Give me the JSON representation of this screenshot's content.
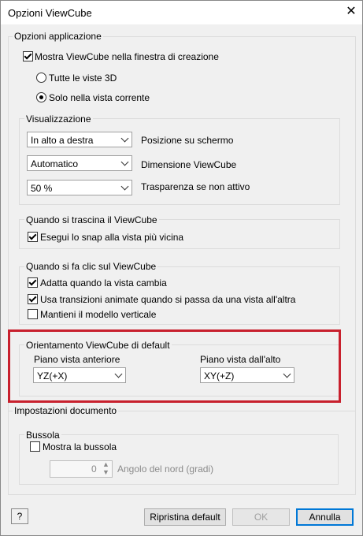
{
  "window": {
    "title": "Opzioni ViewCube",
    "close_icon": "close-icon"
  },
  "app_options": {
    "legend": "Opzioni applicazione",
    "show_viewcube": {
      "label": "Mostra ViewCube nella finestra di creazione",
      "checked": true
    },
    "all_views": {
      "label": "Tutte le viste 3D",
      "selected": false
    },
    "current_view": {
      "label": "Solo nella vista corrente",
      "selected": true
    }
  },
  "display": {
    "legend": "Visualizzazione",
    "position": {
      "value": "In alto a destra",
      "label": "Posizione su schermo"
    },
    "size": {
      "value": "Automatico",
      "label": "Dimensione ViewCube"
    },
    "transparency": {
      "value": "50 %",
      "label": "Trasparenza se non attivo"
    }
  },
  "drag": {
    "legend": "Quando si trascina il ViewCube",
    "snap": {
      "label": "Esegui lo snap alla vista più vicina",
      "checked": true
    }
  },
  "click": {
    "legend": "Quando si fa clic sul ViewCube",
    "fit": {
      "label": "Adatta quando la vista cambia",
      "checked": true
    },
    "animated": {
      "label": "Usa transizioni animate quando si passa da una vista all'altra",
      "checked": true
    },
    "upright": {
      "label": "Mantieni il modello verticale",
      "checked": false
    }
  },
  "orientation": {
    "legend": "Orientamento ViewCube di default",
    "front_label": "Piano vista anteriore",
    "front_value": "YZ(+X)",
    "top_label": "Piano vista dall'alto",
    "top_value": "XY(+Z)",
    "highlight_color": "#c8202d"
  },
  "document": {
    "legend": "Impostazioni documento",
    "compass_legend": "Bussola",
    "show_compass": {
      "label": "Mostra la bussola",
      "checked": false
    },
    "north_angle": {
      "value": "0",
      "label": "Angolo del nord (gradi)"
    }
  },
  "footer": {
    "help_icon": "help-icon",
    "reset_label": "Ripristina default",
    "ok_label": "OK",
    "cancel_label": "Annulla"
  }
}
